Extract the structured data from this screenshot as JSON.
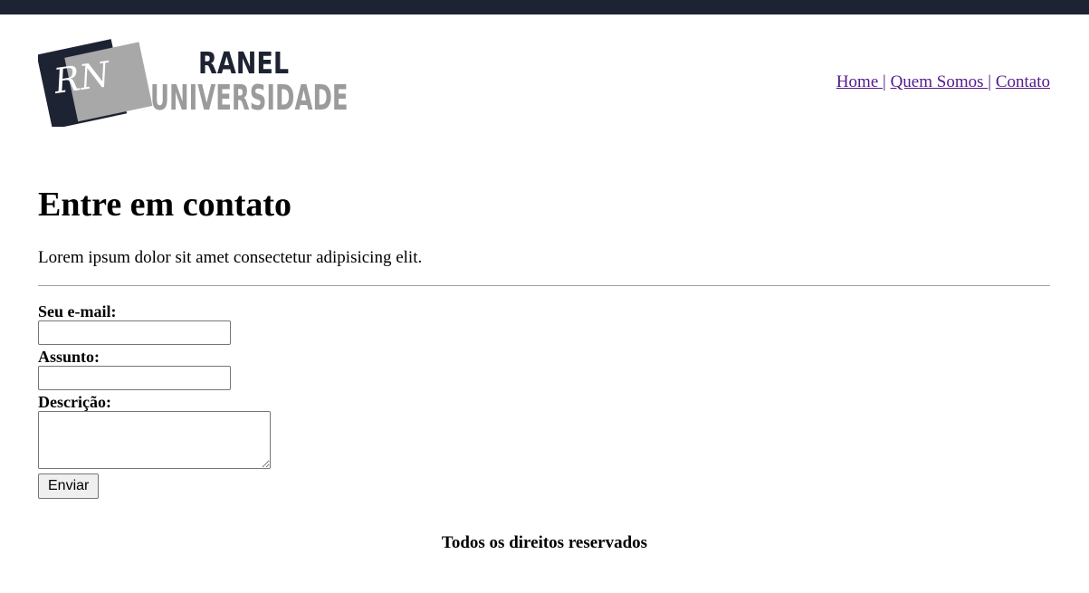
{
  "header": {
    "logo": {
      "monogram": "RN",
      "line1": "RANEL",
      "line2": "UNIVERSIDADE"
    },
    "nav": [
      {
        "label": "Home "
      },
      {
        "label": "Quem Somos "
      },
      {
        "label": "Contato"
      }
    ],
    "nav_separator": "|"
  },
  "main": {
    "title": "Entre em contato",
    "intro": "Lorem ipsum dolor sit amet consectetur adipisicing elit."
  },
  "form": {
    "email_label": "Seu e-mail:",
    "email_value": "",
    "subject_label": "Assunto:",
    "subject_value": "",
    "description_label": "Descrição:",
    "description_value": "",
    "submit_label": "Enviar"
  },
  "footer": {
    "text": "Todos os direitos reservados"
  },
  "colors": {
    "topbar": "#1e2333",
    "logo_dark": "#1e2333",
    "logo_gray": "#9b9b9b",
    "visited_link": "#551a8b"
  }
}
